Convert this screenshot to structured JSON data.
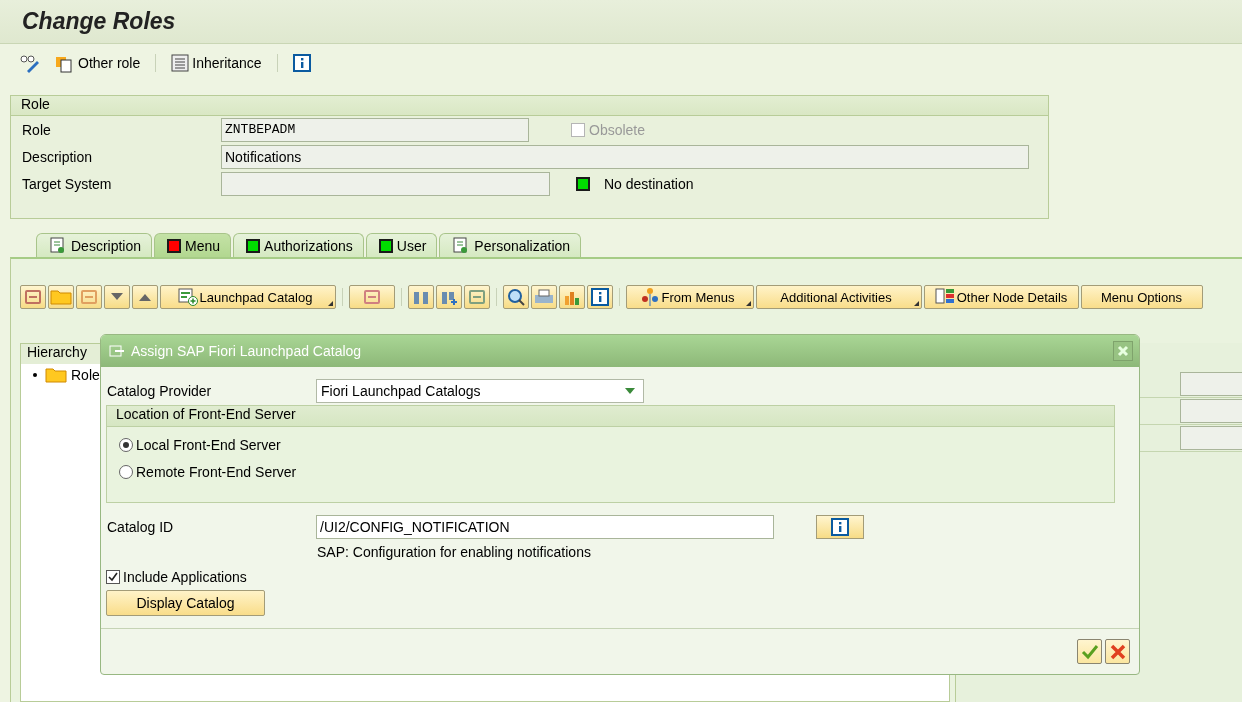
{
  "window": {
    "title": "Change Roles"
  },
  "toolbar": [
    {
      "kind": "plain"
    },
    {
      "kind": "role",
      "label": "Other role"
    },
    {
      "kind": "list",
      "label": "Inheritance"
    },
    {
      "kind": "info"
    }
  ],
  "role_group": {
    "title": "Role",
    "role": {
      "label": "Role",
      "value": "ZNTBEPADM"
    },
    "obsolete": {
      "label": "Obsolete",
      "checked": false,
      "disabled": true
    },
    "description": {
      "label": "Description",
      "value": "Notifications"
    },
    "target_system": {
      "label": "Target System"
    },
    "destination": {
      "label": "No destination",
      "color": "#00dd00"
    }
  },
  "tabs": [
    {
      "kind": "icon",
      "label": "Description",
      "selected": false
    },
    {
      "kind": "status",
      "label": "Menu",
      "selected": true,
      "color": "#ff0000"
    },
    {
      "kind": "status",
      "label": "Authorizations",
      "selected": false,
      "color": "#00dd00"
    },
    {
      "kind": "status",
      "label": "User",
      "selected": false,
      "color": "#00dd00"
    },
    {
      "kind": "icon",
      "label": "Personalization",
      "selected": false
    }
  ],
  "menu_buttons": [
    {
      "kind": "catalog",
      "label": "Launchpad Catalog",
      "dropdown": true
    },
    {
      "kind": "from",
      "label": "From Menus",
      "dropdown": true
    },
    {
      "kind": "plain",
      "label": "Additional Activities",
      "dropdown": true
    },
    {
      "kind": "details",
      "label": "Other Node Details",
      "dropdown": false
    },
    {
      "kind": "plain",
      "label": "Menu Options",
      "dropdown": false
    }
  ],
  "hierarchy": {
    "title": "Hierarchy",
    "items": [
      {
        "label": "Role"
      }
    ]
  },
  "dialog": {
    "title": "Assign SAP Fiori Launchpad Catalog",
    "catalog_provider": {
      "label": "Catalog Provider",
      "value": "Fiori Launchpad Catalogs"
    },
    "location": {
      "title": "Location of Front-End Server",
      "options": [
        {
          "label": "Local Front-End Server",
          "selected": true
        },
        {
          "label": "Remote Front-End Server",
          "selected": false
        }
      ]
    },
    "catalog_id": {
      "label": "Catalog ID",
      "value": "/UI2/CONFIG_NOTIFICATION",
      "description": "SAP: Configuration for enabling notifications"
    },
    "include_applications": {
      "label": "Include Applications",
      "checked": true
    },
    "display_button": "Display Catalog"
  }
}
